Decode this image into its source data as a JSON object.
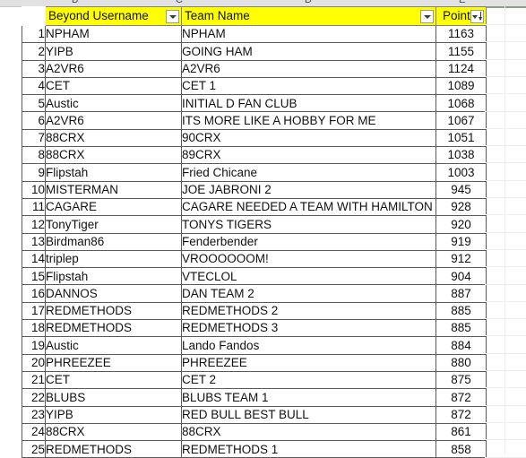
{
  "app": {
    "type": "spreadsheet",
    "column_letter_band_visible": true
  },
  "colors": {
    "header_fill": "#ffff00",
    "header_text": "#111111",
    "grid_border": "#5a5a5a",
    "sheet_background": "#ffffff",
    "ghost_gridline": "#ededed",
    "selection_accent": "#8aa184"
  },
  "column_letters": [
    "B",
    "C",
    "D",
    "E"
  ],
  "table": {
    "headers": {
      "row_number": "",
      "username": "Beyond Username",
      "team": "Team Name",
      "points": "Points"
    },
    "filters": {
      "username_filter": "filter-dropdown",
      "team_filter": "filter-dropdown",
      "points_filter": "sort-descending-filter-dropdown"
    },
    "columns": [
      "#",
      "Beyond Username",
      "Team Name",
      "Points"
    ],
    "rows": [
      {
        "n": "1",
        "user": "NPHAM",
        "team": "NPHAM",
        "pts": "1163"
      },
      {
        "n": "2",
        "user": "YIPB",
        "team": "GOING HAM",
        "pts": "1155"
      },
      {
        "n": "3",
        "user": "A2VR6",
        "team": "A2VR6",
        "pts": "1124"
      },
      {
        "n": "4",
        "user": "CET",
        "team": "CET 1",
        "pts": "1089"
      },
      {
        "n": "5",
        "user": "Austic",
        "team": "INITIAL D FAN CLUB",
        "pts": "1068"
      },
      {
        "n": "6",
        "user": "A2VR6",
        "team": "ITS MORE LIKE A HOBBY FOR ME",
        "pts": "1067"
      },
      {
        "n": "7",
        "user": "88CRX",
        "team": "90CRX",
        "pts": "1051"
      },
      {
        "n": "8",
        "user": "88CRX",
        "team": "89CRX",
        "pts": "1038"
      },
      {
        "n": "9",
        "user": "Flipstah",
        "team": "Fried Chicane",
        "pts": "1003"
      },
      {
        "n": "10",
        "user": "MISTERMAN",
        "team": "JOE JABRONI 2",
        "pts": "945"
      },
      {
        "n": "11",
        "user": "CAGARE",
        "team": "CAGARE NEEDED A TEAM WITH HAMILTON",
        "pts": "928"
      },
      {
        "n": "12",
        "user": "TonyTiger",
        "team": "TONYS TIGERS",
        "pts": "920"
      },
      {
        "n": "13",
        "user": "Birdman86",
        "team": "Fenderbender",
        "pts": "919"
      },
      {
        "n": "14",
        "user": "triplep",
        "team": "VROOOOOOM!",
        "pts": "912"
      },
      {
        "n": "15",
        "user": "Flipstah",
        "team": "VTECLOL",
        "pts": "904"
      },
      {
        "n": "16",
        "user": "DANNOS",
        "team": "DAN TEAM 2",
        "pts": "887"
      },
      {
        "n": "17",
        "user": "REDMETHODS",
        "team": "REDMETHODS 2",
        "pts": "885"
      },
      {
        "n": "18",
        "user": "REDMETHODS",
        "team": "REDMETHODS 3",
        "pts": "885"
      },
      {
        "n": "19",
        "user": "Austic",
        "team": "Lando Fandos",
        "pts": "884"
      },
      {
        "n": "20",
        "user": "PHREEZEE",
        "team": "PHREEZEE",
        "pts": "880"
      },
      {
        "n": "21",
        "user": "CET",
        "team": "CET 2",
        "pts": "875"
      },
      {
        "n": "22",
        "user": "BLUBS",
        "team": "BLUBS TEAM 1",
        "pts": "872"
      },
      {
        "n": "23",
        "user": "YIPB",
        "team": "RED BULL BEST BULL",
        "pts": "872"
      },
      {
        "n": "24",
        "user": "88CRX",
        "team": "88CRX",
        "pts": "861"
      },
      {
        "n": "25",
        "user": "REDMETHODS",
        "team": "REDMETHODS 1",
        "pts": "858"
      }
    ]
  }
}
